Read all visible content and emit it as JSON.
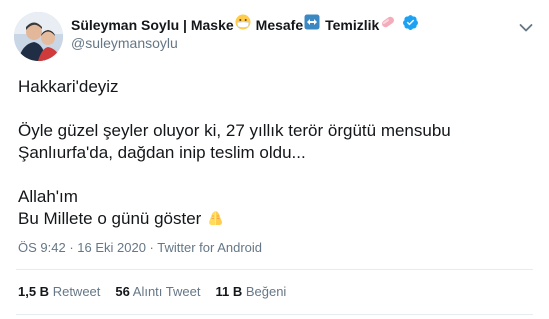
{
  "author": {
    "name_part1": "Süleyman Soylu | Maske",
    "name_part2": "Mesafe",
    "name_part3": "Temizlik",
    "name_emojis": [
      "face-with-medical-mask-emoji",
      "left-right-arrow-emoji",
      "soap-emoji"
    ],
    "verified_icon": "verified-badge-icon",
    "handle": "@suleymansoylu"
  },
  "tweet": {
    "line1": "Hakkari'deyiz",
    "line2": "Öyle güzel şeyler oluyor ki, 27 yıllık terör örgütü mensubu",
    "line3": "Şanlıurfa'da, dağdan inip teslim oldu...",
    "line4": "Allah'ım",
    "line5": "Bu Millete o günü göster",
    "trailing_emoji": "folded-hands-emoji"
  },
  "meta": {
    "time": "ÖS 9:42",
    "separator1": " · ",
    "date": "16 Eki 2020",
    "separator2": " · ",
    "source": "Twitter for Android"
  },
  "stats": {
    "retweets_count": "1,5 B",
    "retweets_label": "Retweet",
    "quotes_count": "56",
    "quotes_label": "Alıntı Tweet",
    "likes_count": "11 B",
    "likes_label": "Beğeni"
  },
  "colors": {
    "text": "#14171a",
    "secondary": "#657786",
    "verified": "#1da1f2",
    "divider": "#e6ecf0"
  }
}
